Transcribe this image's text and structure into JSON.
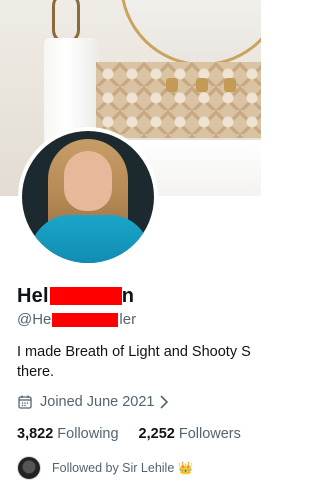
{
  "profile": {
    "display_name_visible": "Hel",
    "display_name_tail": "n",
    "handle_visible": "@He",
    "handle_tail": "ler",
    "bio": "I made Breath of Light and Shooty S there.",
    "bio_line1": "I made Breath of Light and Shooty S",
    "bio_line2": "there.",
    "joined": "Joined June 2021",
    "following_count": "3,822",
    "following_label": "Following",
    "followers_count": "2,252",
    "followers_label": "Followers",
    "followed_by": "Followed by Sir Lehile",
    "followed_by_badge": "👑"
  },
  "icons": {
    "joined": "calendar-icon",
    "joined_chevron": "chevron-right-icon"
  },
  "colors": {
    "redaction": "#ff0000",
    "muted_text": "#536471",
    "primary_text": "#0f1419"
  }
}
